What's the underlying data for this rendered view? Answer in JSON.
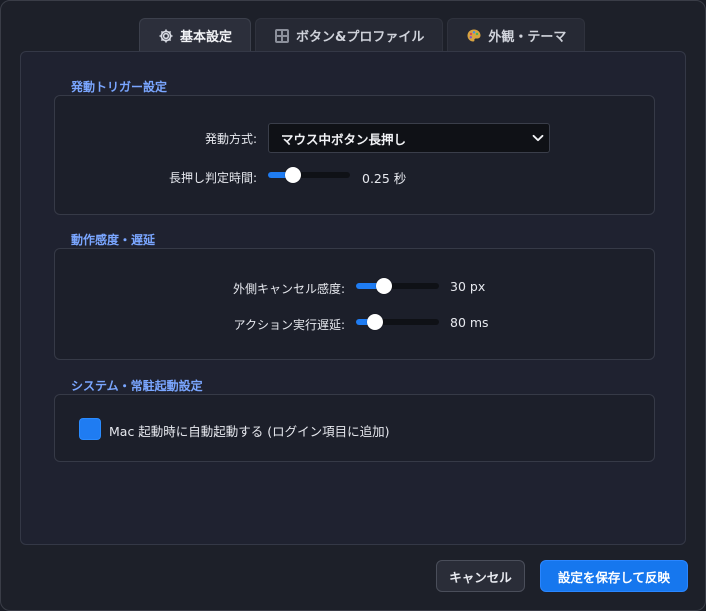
{
  "tabs": [
    {
      "label": "基本設定",
      "icon": "gear-icon",
      "active": true
    },
    {
      "label": "ボタン&プロファイル",
      "icon": "grid-icon",
      "active": false
    },
    {
      "label": "外観・テーマ",
      "icon": "palette-icon",
      "active": false
    }
  ],
  "trigger": {
    "title": "発動トリガー設定",
    "method_label": "発動方式:",
    "method_value": "マウス中ボタン長押し",
    "longpress_label": "長押し判定時間:",
    "longpress_value": 0.25,
    "longpress_text": "0.25 秒"
  },
  "sensitivity": {
    "title": "動作感度・遅延",
    "cancel_label": "外側キャンセル感度:",
    "cancel_value": 30,
    "cancel_text": "30 px",
    "delay_label": "アクション実行遅延:",
    "delay_value": 80,
    "delay_text": "80 ms"
  },
  "system": {
    "title": "システム・常駐起動設定",
    "autostart_label": "Mac 起動時に自動起動する (ログイン項目に追加)",
    "autostart_checked": true
  },
  "buttons": {
    "cancel": "キャンセル",
    "save": "設定を保存して反映"
  },
  "colors": {
    "accent": "#1f7cf2",
    "section_title": "#7aa6ff",
    "background": "#1d2029"
  }
}
